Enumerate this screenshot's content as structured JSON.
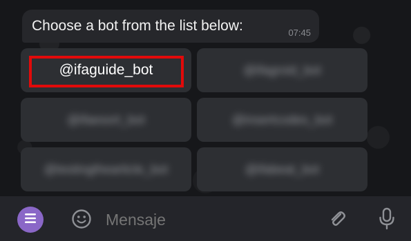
{
  "message": {
    "text": "Choose a bot from the list below:",
    "time": "07:45"
  },
  "keyboard": {
    "buttons": [
      {
        "label": "@ifaguide_bot",
        "blurred": false
      },
      {
        "label": "@ifagroid_bot",
        "blurred": true
      },
      {
        "label": "@ifaesort_bot",
        "blurred": true
      },
      {
        "label": "@insertcodes_bot",
        "blurred": true
      },
      {
        "label": "@testingthearticle_bot",
        "blurred": true
      },
      {
        "label": "@ifabeat_bot",
        "blurred": true
      }
    ]
  },
  "input": {
    "placeholder": "Mensaje"
  },
  "icons": {
    "menu": "menu-icon",
    "emoji": "emoji-icon",
    "attach": "paperclip-icon",
    "voice": "microphone-icon"
  },
  "colors": {
    "highlight": "#e10a0a",
    "menu_button": "#8a67c7"
  }
}
